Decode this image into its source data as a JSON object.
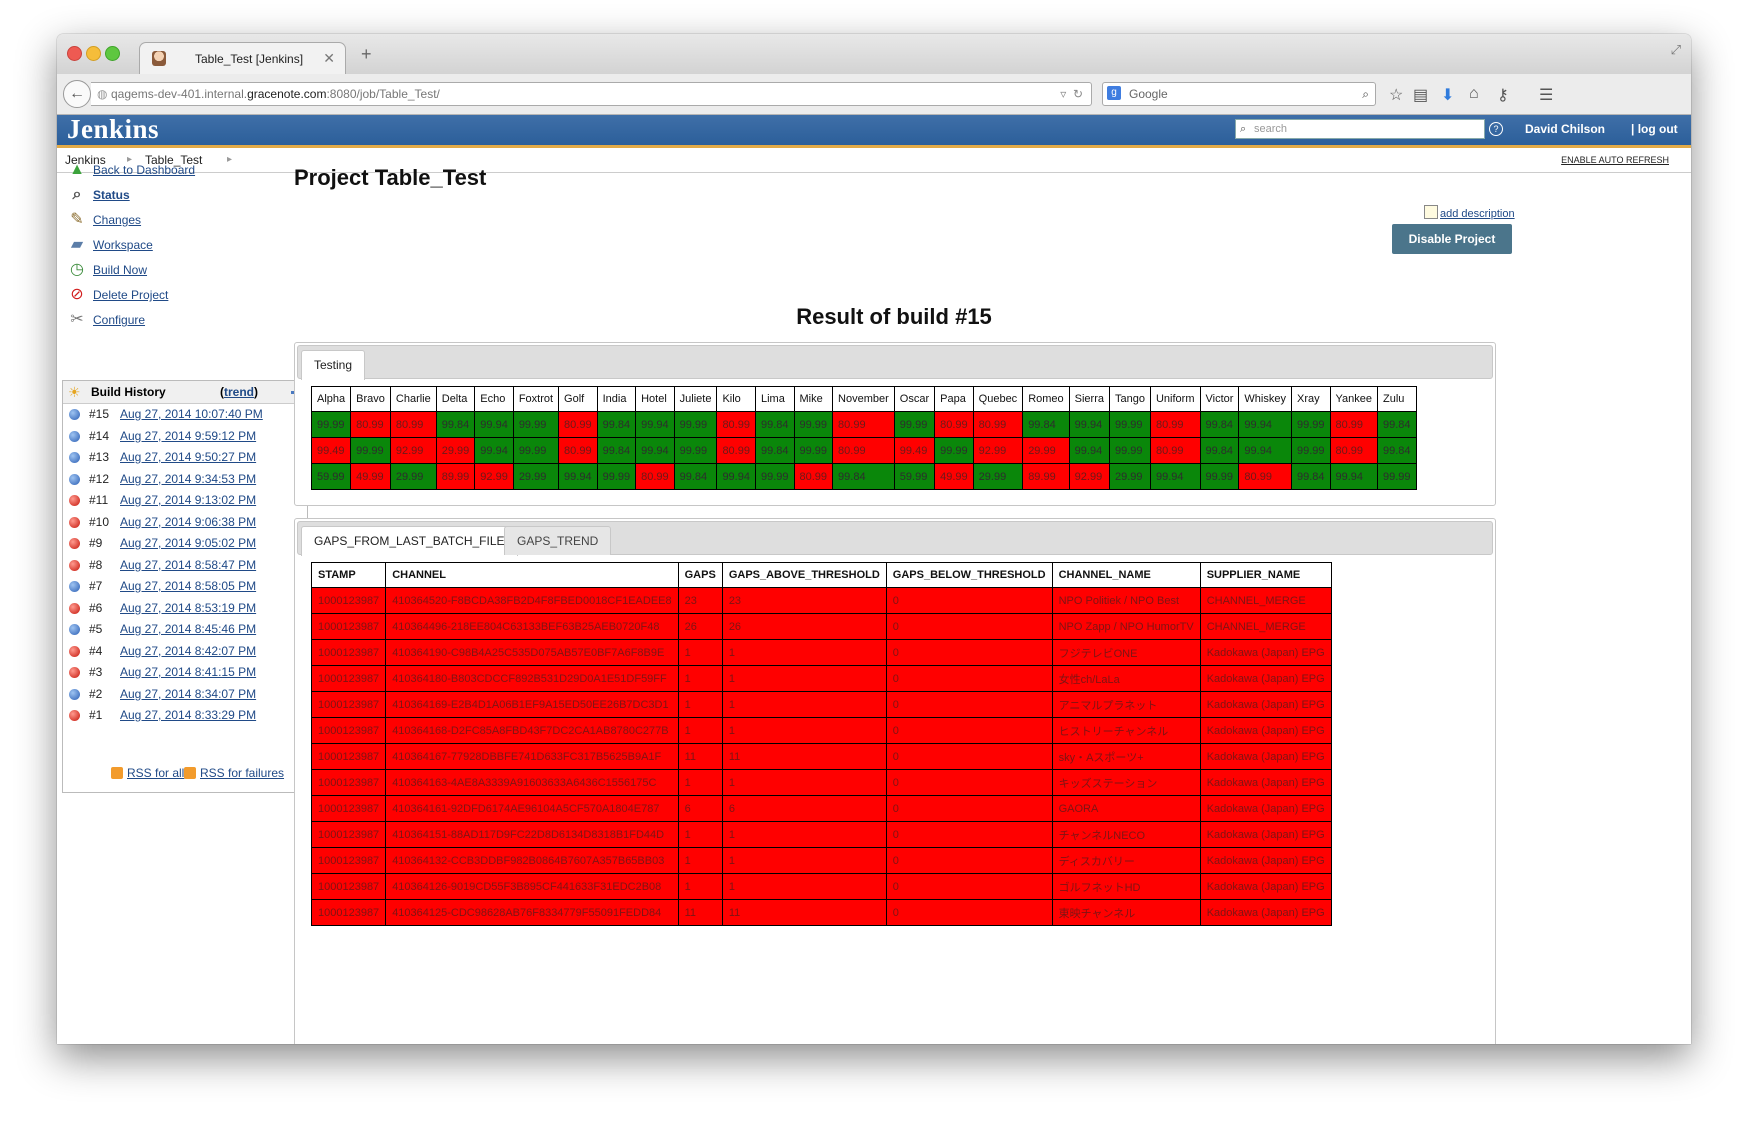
{
  "browser": {
    "tab_title": "Table_Test [Jenkins]",
    "url_prefix": "qagems-dev-401.internal.",
    "url_host": "gracenote.com",
    "url_suffix": ":8080/job/Table_Test/",
    "search_placeholder": "Google"
  },
  "jenkins": {
    "logo": "Jenkins",
    "search_placeholder": "search",
    "user": "David Chilson",
    "logout": "| log out"
  },
  "breadcrumb": {
    "root": "Jenkins",
    "job": "Table_Test",
    "auto_refresh": "ENABLE AUTO REFRESH"
  },
  "tasks": [
    {
      "label": "Back to Dashboard",
      "icon": "up-arrow-icon"
    },
    {
      "label": "Status",
      "icon": "magnifier-icon"
    },
    {
      "label": "Changes",
      "icon": "notepad-icon"
    },
    {
      "label": "Workspace",
      "icon": "folder-icon"
    },
    {
      "label": "Build Now",
      "icon": "clock-icon"
    },
    {
      "label": "Delete Project",
      "icon": "no-entry-icon"
    },
    {
      "label": "Configure",
      "icon": "tools-icon"
    }
  ],
  "build_history": {
    "title": "Build History",
    "trend": "trend",
    "builds": [
      {
        "num": "#15",
        "date": "Aug 27, 2014 10:07:40 PM",
        "status": "blue"
      },
      {
        "num": "#14",
        "date": "Aug 27, 2014 9:59:12 PM",
        "status": "blue"
      },
      {
        "num": "#13",
        "date": "Aug 27, 2014 9:50:27 PM",
        "status": "blue"
      },
      {
        "num": "#12",
        "date": "Aug 27, 2014 9:34:53 PM",
        "status": "blue"
      },
      {
        "num": "#11",
        "date": "Aug 27, 2014 9:13:02 PM",
        "status": "red"
      },
      {
        "num": "#10",
        "date": "Aug 27, 2014 9:06:38 PM",
        "status": "red"
      },
      {
        "num": "#9",
        "date": "Aug 27, 2014 9:05:02 PM",
        "status": "red"
      },
      {
        "num": "#8",
        "date": "Aug 27, 2014 8:58:47 PM",
        "status": "red"
      },
      {
        "num": "#7",
        "date": "Aug 27, 2014 8:58:05 PM",
        "status": "blue"
      },
      {
        "num": "#6",
        "date": "Aug 27, 2014 8:53:19 PM",
        "status": "red"
      },
      {
        "num": "#5",
        "date": "Aug 27, 2014 8:45:46 PM",
        "status": "blue"
      },
      {
        "num": "#4",
        "date": "Aug 27, 2014 8:42:07 PM",
        "status": "red"
      },
      {
        "num": "#3",
        "date": "Aug 27, 2014 8:41:15 PM",
        "status": "red"
      },
      {
        "num": "#2",
        "date": "Aug 27, 2014 8:34:07 PM",
        "status": "blue"
      },
      {
        "num": "#1",
        "date": "Aug 27, 2014 8:33:29 PM",
        "status": "red"
      }
    ],
    "rss_all": "RSS for all",
    "rss_failures": "RSS for failures"
  },
  "main": {
    "title": "Project Table_Test",
    "add_description": "add description",
    "disable_button": "Disable Project",
    "result_title": "Result of build #15"
  },
  "testing": {
    "tab": "Testing",
    "columns": [
      "Alpha",
      "Bravo",
      "Charlie",
      "Delta",
      "Echo",
      "Foxtrot",
      "Golf",
      "India",
      "Hotel",
      "Juliete",
      "Kilo",
      "Lima",
      "Mike",
      "November",
      "Oscar",
      "Papa",
      "Quebec",
      "Romeo",
      "Sierra",
      "Tango",
      "Uniform",
      "Victor",
      "Whiskey",
      "Xray",
      "Yankee",
      "Zulu"
    ],
    "rows": [
      [
        "99.99",
        "80.99",
        "80.99",
        "99.84",
        "99.94",
        "99.99",
        "80.99",
        "99.84",
        "99.94",
        "99.99",
        "80.99",
        "99.84",
        "99.99",
        "80.99",
        "99.99",
        "80.99",
        "80.99",
        "99.84",
        "99.94",
        "99.99",
        "80.99",
        "99.84",
        "99.94",
        "99.99",
        "80.99",
        "99.84"
      ],
      [
        "99.49",
        "99.99",
        "92.99",
        "29.99",
        "99.94",
        "99.99",
        "80.99",
        "99.84",
        "99.94",
        "99.99",
        "80.99",
        "99.84",
        "99.99",
        "80.99",
        "99.49",
        "99.99",
        "92.99",
        "29.99",
        "99.94",
        "99.99",
        "80.99",
        "99.84",
        "99.94",
        "99.99",
        "80.99",
        "99.84"
      ],
      [
        "59.99",
        "49.99",
        "29.99",
        "89.99",
        "92.99",
        "29.99",
        "99.94",
        "99.99",
        "80.99",
        "99.84",
        "99.94",
        "99.99",
        "80.99",
        "99.84",
        "59.99",
        "49.99",
        "29.99",
        "89.99",
        "92.99",
        "29.99",
        "99.94",
        "99.99",
        "80.99",
        "99.84",
        "99.94",
        "99.99"
      ]
    ],
    "colors": [
      [
        "g",
        "r",
        "r",
        "g",
        "g",
        "g",
        "r",
        "g",
        "g",
        "g",
        "r",
        "g",
        "g",
        "r",
        "g",
        "r",
        "r",
        "g",
        "g",
        "g",
        "r",
        "g",
        "g",
        "g",
        "r",
        "g"
      ],
      [
        "r",
        "g",
        "r",
        "r",
        "g",
        "g",
        "r",
        "g",
        "g",
        "g",
        "r",
        "g",
        "g",
        "r",
        "r",
        "g",
        "r",
        "r",
        "g",
        "g",
        "r",
        "g",
        "g",
        "g",
        "r",
        "g"
      ],
      [
        "g",
        "r",
        "g",
        "r",
        "r",
        "g",
        "g",
        "g",
        "r",
        "g",
        "g",
        "g",
        "r",
        "g",
        "g",
        "r",
        "g",
        "r",
        "r",
        "g",
        "g",
        "g",
        "r",
        "g",
        "g",
        "g"
      ]
    ]
  },
  "gaps": {
    "tabs": [
      "GAPS_FROM_LAST_BATCH_FILE",
      "GAPS_TREND"
    ],
    "columns": [
      "STAMP",
      "CHANNEL",
      "GAPS",
      "GAPS_ABOVE_THRESHOLD",
      "GAPS_BELOW_THRESHOLD",
      "CHANNEL_NAME",
      "SUPPLIER_NAME"
    ],
    "rows": [
      [
        "1000123987",
        "410364520-F8BCDA38FB2D4F8FBED0018CF1EADEE8",
        "23",
        "23",
        "0",
        "NPO Politiek / NPO Best",
        "CHANNEL_MERGE"
      ],
      [
        "1000123987",
        "410364496-218EE804C63133BEF63B25AEB0720F48",
        "26",
        "26",
        "0",
        "NPO Zapp / NPO HumorTV",
        "CHANNEL_MERGE"
      ],
      [
        "1000123987",
        "410364190-C98B4A25C535D075AB57E0BF7A6F8B9E",
        "1",
        "1",
        "0",
        "フジテレビONE",
        "Kadokawa (Japan) EPG"
      ],
      [
        "1000123987",
        "410364180-B803CDCCF892B531D29D0A1E51DF59FF",
        "1",
        "1",
        "0",
        "女性ch/LaLa",
        "Kadokawa (Japan) EPG"
      ],
      [
        "1000123987",
        "410364169-E2B4D1A06B1EF9A15ED50EE26B7DC3D1",
        "1",
        "1",
        "0",
        "アニマルプラネット",
        "Kadokawa (Japan) EPG"
      ],
      [
        "1000123987",
        "410364168-D2FC85A8FBD43F7DC2CA1AB8780C277B",
        "1",
        "1",
        "0",
        "ヒストリーチャンネル",
        "Kadokawa (Japan) EPG"
      ],
      [
        "1000123987",
        "410364167-77928DBBFE741D633FC317B5625B9A1F",
        "11",
        "11",
        "0",
        "sky・Aスポーツ+",
        "Kadokawa (Japan) EPG"
      ],
      [
        "1000123987",
        "410364163-4AE8A3339A91603633A6436C1556175C",
        "1",
        "1",
        "0",
        "キッズステーション",
        "Kadokawa (Japan) EPG"
      ],
      [
        "1000123987",
        "410364161-92DFD6174AE96104A5CF570A1804E787",
        "6",
        "6",
        "0",
        "GAORA",
        "Kadokawa (Japan) EPG"
      ],
      [
        "1000123987",
        "410364151-88AD117D9FC22D8D6134D8318B1FD44D",
        "1",
        "1",
        "0",
        "チャンネルNECO",
        "Kadokawa (Japan) EPG"
      ],
      [
        "1000123987",
        "410364132-CCB3DDBF982B0864B7607A357B65BB03",
        "1",
        "1",
        "0",
        "ディスカバリー",
        "Kadokawa (Japan) EPG"
      ],
      [
        "1000123987",
        "410364126-9019CD55F3B895CF441633F31EDC2B08",
        "1",
        "1",
        "0",
        "ゴルフネットHD",
        "Kadokawa (Japan) EPG"
      ],
      [
        "1000123987",
        "410364125-CDC98628AB76F8334779F55091FEDD84",
        "11",
        "11",
        "0",
        "東映チャンネル",
        "Kadokawa (Japan) EPG"
      ]
    ]
  }
}
